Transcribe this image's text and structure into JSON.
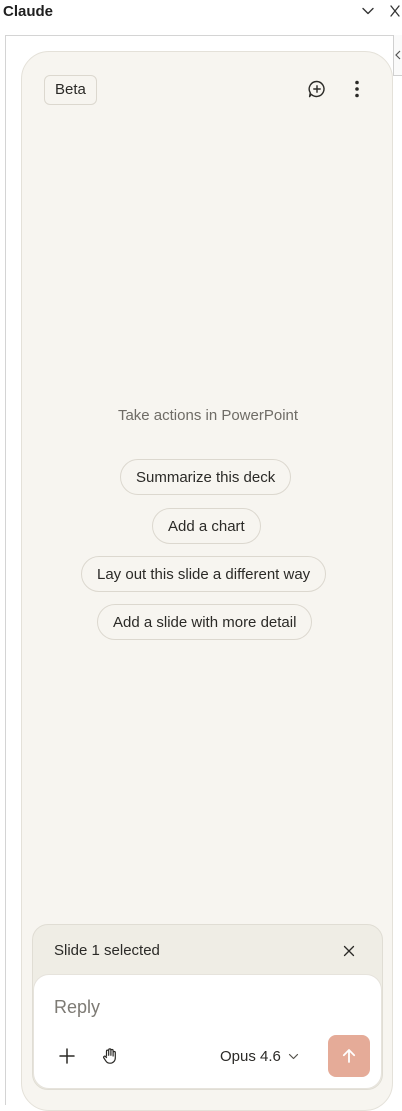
{
  "window": {
    "title": "Claude",
    "collapse_icon": "chevron-down-icon",
    "close_icon": "close-icon",
    "side_icon": "chevron-left-icon"
  },
  "panel": {
    "badge": "Beta",
    "new_chat_icon": "chat-plus-icon",
    "menu_icon": "more-vertical-icon"
  },
  "empty_state": {
    "title": "Take actions in PowerPoint",
    "suggestions": [
      "Summarize this deck",
      "Add a chart",
      "Lay out this slide a different way",
      "Add a slide with more detail"
    ]
  },
  "composer": {
    "context_label": "Slide 1 selected",
    "context_close_icon": "close-icon",
    "placeholder": "Reply",
    "value": "",
    "attach_icon": "plus-icon",
    "hand_icon": "hand-icon",
    "model": "Opus 4.6",
    "model_chevron_icon": "chevron-down-icon",
    "send_icon": "arrow-up-icon"
  },
  "colors": {
    "panel_bg": "#f7f5f0",
    "composer_bg": "#efede5",
    "send_button": "#e5ab98",
    "muted_text": "#6f6c66"
  }
}
